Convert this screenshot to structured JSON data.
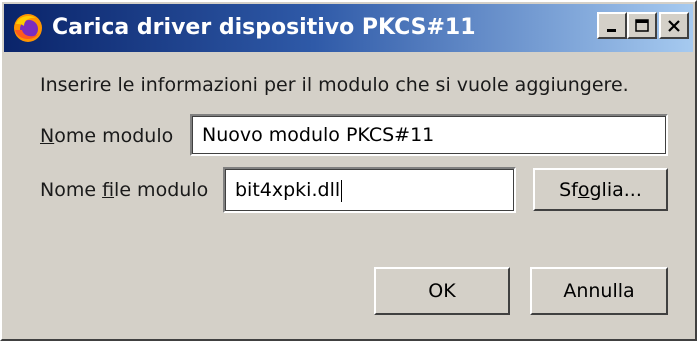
{
  "window": {
    "title": "Carica driver dispositivo PKCS#11",
    "icon": "firefox-icon",
    "controls": {
      "minimize_icon": "minimize-icon",
      "maximize_icon": "maximize-icon",
      "close_icon": "close-icon"
    }
  },
  "form": {
    "info_text": "Inserire le informazioni per il modulo che si vuole aggiungere.",
    "module_name": {
      "label_mnemonic": "N",
      "label_rest": "ome modulo",
      "value": "Nuovo modulo PKCS#11"
    },
    "module_file": {
      "label_pre": "Nome ",
      "label_mnemonic": "f",
      "label_post": "ile modulo",
      "value": "bit4xpki.dll",
      "browse_pre": "Sf",
      "browse_mnemonic": "o",
      "browse_post": "glia..."
    }
  },
  "buttons": {
    "ok": "OK",
    "cancel": "Annulla"
  },
  "colors": {
    "titlebar_start": "#0a246a",
    "titlebar_end": "#a6caf0",
    "dialog_bg": "#d4d0c8"
  }
}
